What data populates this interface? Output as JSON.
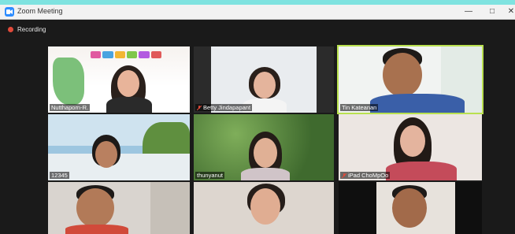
{
  "window": {
    "title": "Zoom Meeting"
  },
  "recording": {
    "label": "Recording"
  },
  "participants": [
    {
      "name": "Nutthaporn-R.",
      "muted": false
    },
    {
      "name": "Betty Jindapapant",
      "muted": true
    },
    {
      "name": "Tin Kateanan",
      "muted": false
    },
    {
      "name": "12345",
      "muted": false
    },
    {
      "name": "thunyanut",
      "muted": false
    },
    {
      "name": "iPad ChoMpOo",
      "muted": true
    }
  ],
  "colors": {
    "active_speaker": "#b9e04f",
    "recording_dot": "#e04a3a",
    "muted_icon": "#e04a3a"
  }
}
